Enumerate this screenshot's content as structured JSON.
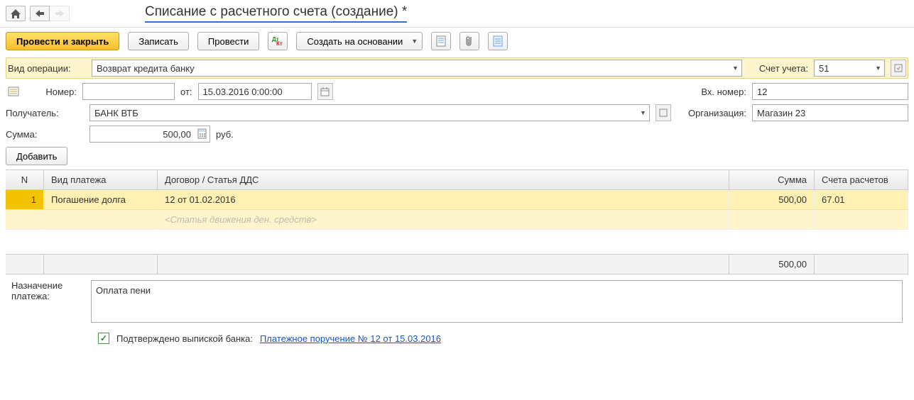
{
  "title": "Списание с расчетного счета (создание) *",
  "toolbar": {
    "post_and_close": "Провести и закрыть",
    "save": "Записать",
    "post": "Провести",
    "create_based_on": "Создать на основании"
  },
  "labels": {
    "operation_type": "Вид операции:",
    "number": "Номер:",
    "from": "от:",
    "recipient": "Получатель:",
    "amount": "Сумма:",
    "currency": "руб.",
    "add": "Добавить",
    "account": "Счет учета:",
    "incoming_number": "Вх. номер:",
    "organization": "Организация:",
    "payment_purpose": "Назначение платежа:",
    "confirmed": "Подтверждено выпиской банка:"
  },
  "fields": {
    "operation_type": "Возврат кредита банку",
    "number": "",
    "date": "15.03.2016  0:00:00",
    "recipient": "БАНК ВТБ",
    "amount": "500,00",
    "account": "51",
    "incoming_number": "12",
    "organization": "Магазин 23",
    "payment_purpose": "Оплата пени"
  },
  "table": {
    "headers": {
      "n": "N",
      "payment_type": "Вид платежа",
      "contract": "Договор / Статья ДДС",
      "sum": "Сумма",
      "settlement_accounts": "Счета расчетов"
    },
    "rows": [
      {
        "n": "1",
        "payment_type": "Погашение долга",
        "contract": "12 от 01.02.2016",
        "dds_placeholder": "<Статья движения ден. средств>",
        "sum": "500,00",
        "acct": "67.01"
      }
    ],
    "totals": {
      "sum": "500,00"
    }
  },
  "confirmation_link": "Платежное поручение № 12 от 15.03.2016"
}
